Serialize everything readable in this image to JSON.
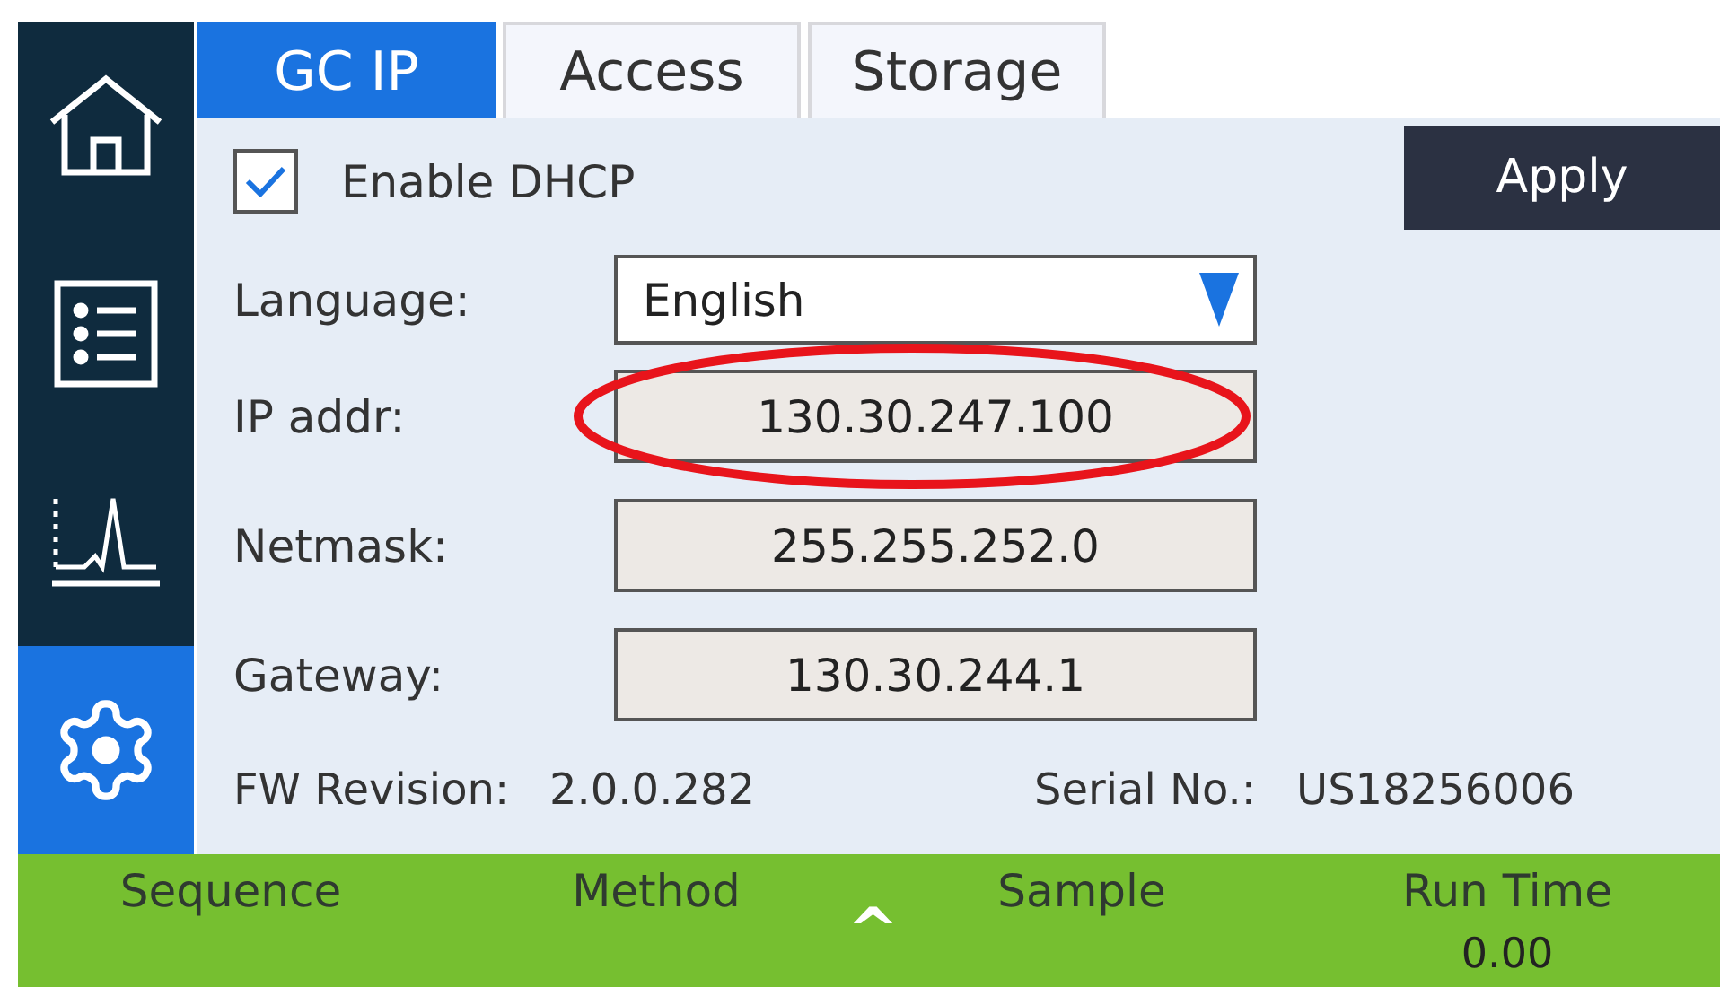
{
  "sidebar": {
    "items": [
      {
        "kind": "home",
        "selected": false
      },
      {
        "kind": "list",
        "selected": false
      },
      {
        "kind": "chart",
        "selected": false
      },
      {
        "kind": "settings",
        "selected": true
      }
    ]
  },
  "tabs": [
    {
      "label": "GC IP",
      "selected": true
    },
    {
      "label": "Access",
      "selected": false
    },
    {
      "label": "Storage",
      "selected": false
    }
  ],
  "dhcp": {
    "label": "Enable DHCP",
    "checked": true
  },
  "apply_button": "Apply",
  "language": {
    "label": "Language:",
    "value": "English"
  },
  "fields": [
    {
      "label": "IP addr:",
      "value": "130.30.247.100",
      "highlighted": true
    },
    {
      "label": "Netmask:",
      "value": "255.255.252.0",
      "highlighted": false
    },
    {
      "label": "Gateway:",
      "value": "130.30.244.1",
      "highlighted": false
    }
  ],
  "info": {
    "fw_label": "FW Revision:",
    "fw_value": "2.0.0.282",
    "serial_label": "Serial No.:",
    "serial_value": "US18256006"
  },
  "status_bar": {
    "items": [
      {
        "label": "Sequence"
      },
      {
        "label": "Method"
      },
      {
        "label": "Sample"
      },
      {
        "label": "Run Time",
        "value": "0.00"
      }
    ],
    "expander": "^"
  }
}
